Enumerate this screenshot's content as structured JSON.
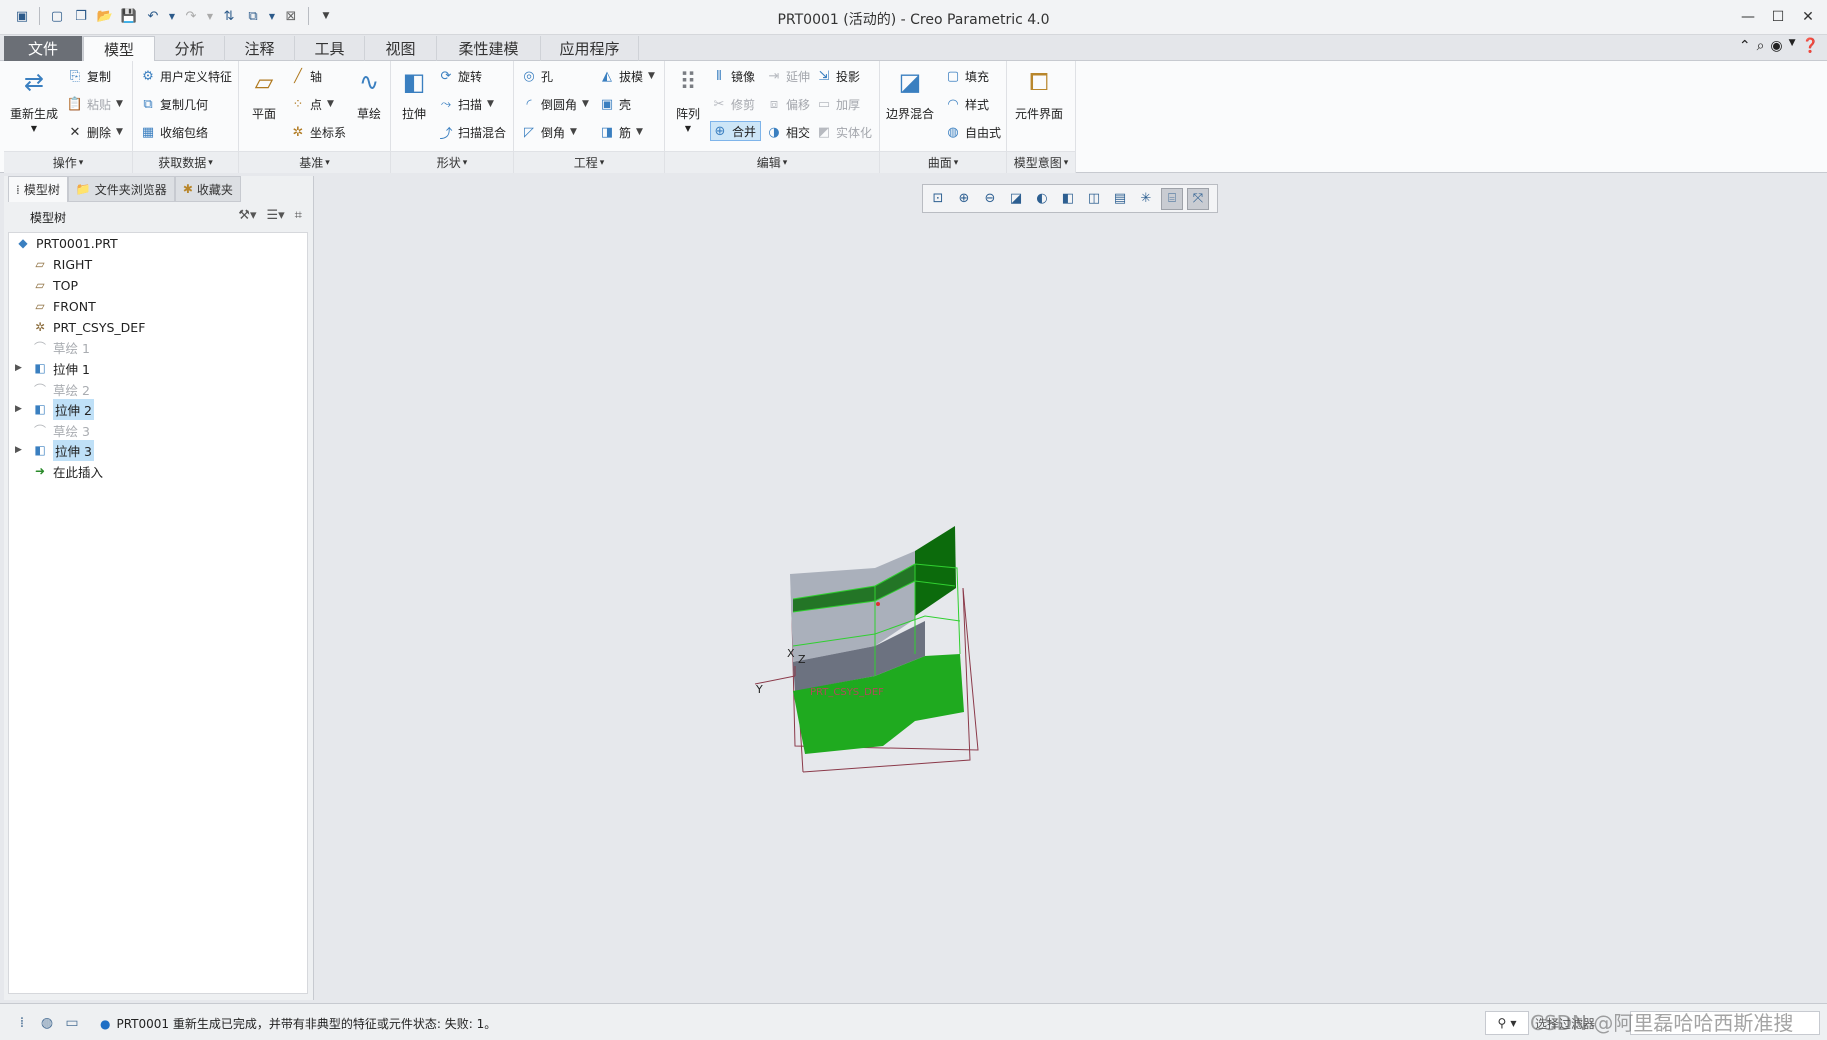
{
  "window": {
    "title": "PRT0001 (活动的) - Creo Parametric 4.0",
    "minimize": "—",
    "maximize": "☐",
    "close": "✕"
  },
  "qat": [
    "app-icon",
    "new-icon",
    "open-folder-icon",
    "open-icon",
    "save-icon",
    "undo-icon",
    "redo-icon",
    "regenerate-icon",
    "windows-icon",
    "close-window-icon",
    "customize-icon"
  ],
  "tabs": [
    "文件",
    "模型",
    "分析",
    "注释",
    "工具",
    "视图",
    "柔性建模",
    "应用程序"
  ],
  "ribbon": {
    "ops": {
      "title": "操作",
      "regen": "重新生成",
      "copy": "复制",
      "paste": "粘贴",
      "delete": "删除"
    },
    "getdata": {
      "title": "获取数据",
      "udf": "用户定义特征",
      "copygeom": "复制几何",
      "shrinkwrap": "收缩包络"
    },
    "datum": {
      "title": "基准",
      "plane": "平面",
      "axis": "轴",
      "point": "点",
      "csys": "坐标系",
      "sketch": "草绘"
    },
    "shapes": {
      "title": "形状",
      "extrude": "拉伸",
      "revolve": "旋转",
      "sweep": "扫描",
      "sweepblend": "扫描混合"
    },
    "eng": {
      "title": "工程",
      "hole": "孔",
      "round": "倒圆角",
      "chamfer": "倒角",
      "draft": "拔模",
      "shell": "壳",
      "rib": "筋"
    },
    "edit": {
      "title": "编辑",
      "pattern": "阵列",
      "mirror": "镜像",
      "trim": "修剪",
      "merge": "合并",
      "extend": "延伸",
      "offset": "偏移",
      "intersect": "相交",
      "project": "投影",
      "thicken": "加厚",
      "solidify": "实体化"
    },
    "surfaces": {
      "title": "曲面",
      "boundary": "边界混合",
      "fill": "填充",
      "style": "样式",
      "freestyle": "自由式"
    },
    "intent": {
      "title": "模型意图",
      "component": "元件界面"
    }
  },
  "panel": {
    "tabs": [
      "模型树",
      "文件夹浏览器",
      "收藏夹"
    ],
    "header": "模型树",
    "tree": [
      {
        "label": "PRT0001.PRT",
        "icon": "part-icon",
        "kind": "root"
      },
      {
        "label": "RIGHT",
        "icon": "datum-plane-icon",
        "kind": "item"
      },
      {
        "label": "TOP",
        "icon": "datum-plane-icon",
        "kind": "item"
      },
      {
        "label": "FRONT",
        "icon": "datum-plane-icon",
        "kind": "item"
      },
      {
        "label": "PRT_CSYS_DEF",
        "icon": "csys-icon",
        "kind": "item"
      },
      {
        "label": "草绘 1",
        "icon": "sketch-icon",
        "kind": "dim"
      },
      {
        "label": "拉伸 1",
        "icon": "extrude-icon",
        "kind": "expand"
      },
      {
        "label": "草绘 2",
        "icon": "sketch-icon",
        "kind": "dim"
      },
      {
        "label": "拉伸 2",
        "icon": "extrude-icon",
        "kind": "expand-hl"
      },
      {
        "label": "草绘 3",
        "icon": "sketch-icon",
        "kind": "dim"
      },
      {
        "label": "拉伸 3",
        "icon": "extrude-icon",
        "kind": "expand-hl"
      },
      {
        "label": "在此插入",
        "icon": "insert-arrow-icon",
        "kind": "insert"
      }
    ]
  },
  "viewport": {
    "axis_x": "X",
    "axis_y": "Y",
    "axis_z": "Z",
    "csys_label": "PRT_CSYS_DEF"
  },
  "status": {
    "message": "PRT0001 重新生成已完成，并带有非典型的特征或元件状态: 失败: 1。",
    "filter": "选择过滤器",
    "watermark": "CSDN @阿里磊哈哈西斯准搜"
  },
  "colors": {
    "green": "#1faa1f",
    "darkgreen": "#0c6b0c",
    "grey": "#9ea4ae"
  }
}
